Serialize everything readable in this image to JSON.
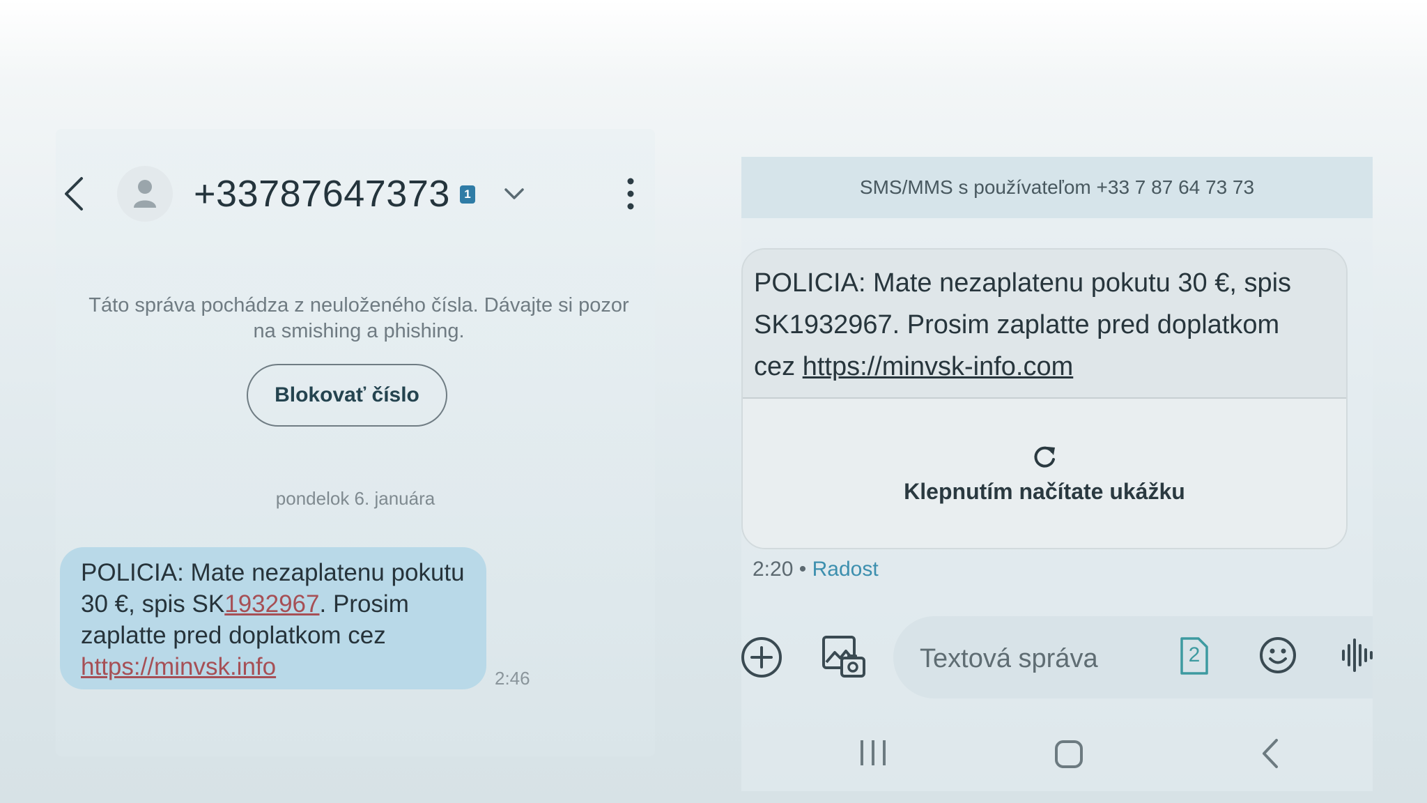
{
  "left_screen": {
    "contact_number": "+33787647373",
    "sim_badge": "1",
    "warning": "Táto správa pochádza z neuloženého čísla. Dávajte si pozor na smishing a phishing.",
    "block_button": "Blokovať číslo",
    "date_separator": "pondelok 6. januára",
    "message": {
      "part1": "POLICIA: Mate nezaplatenu pokutu 30 €, spis SK",
      "ref_link": "1932967",
      "part2": ". Prosim zaplatte pred doplatkom cez ",
      "url": "https://minvsk.info"
    },
    "time": "2:46",
    "icons": [
      "back-arrow-icon",
      "contact-avatar-icon",
      "sim-badge-icon",
      "chevron-down-icon",
      "more-vert-icon"
    ]
  },
  "right_screen": {
    "header": "SMS/MMS s používateľom +33 7 87 64 73 73",
    "message": {
      "text": "POLICIA: Mate nezaplatenu pokutu 30 €, spis SK1932967. Prosim zaplatte pred doplatkom cez ",
      "url": "https://minvsk-info.com"
    },
    "preview_label": "Klepnutím načítate ukážku",
    "time": "2:20",
    "separator": "•",
    "status": "Radost",
    "compose_placeholder": "Textová správa",
    "sim_number": "2",
    "icons": [
      "refresh-icon",
      "add-circle-icon",
      "gallery-icon",
      "sim-2-icon",
      "emoji-icon",
      "voice-icon",
      "nav-recents-icon",
      "nav-home-icon",
      "nav-back-icon"
    ]
  },
  "colors": {
    "left_bubble": "#b9d9e8",
    "link_red": "#a64f55",
    "status_blue": "#3c8fae",
    "sim_badge": "#2f7ca6"
  }
}
